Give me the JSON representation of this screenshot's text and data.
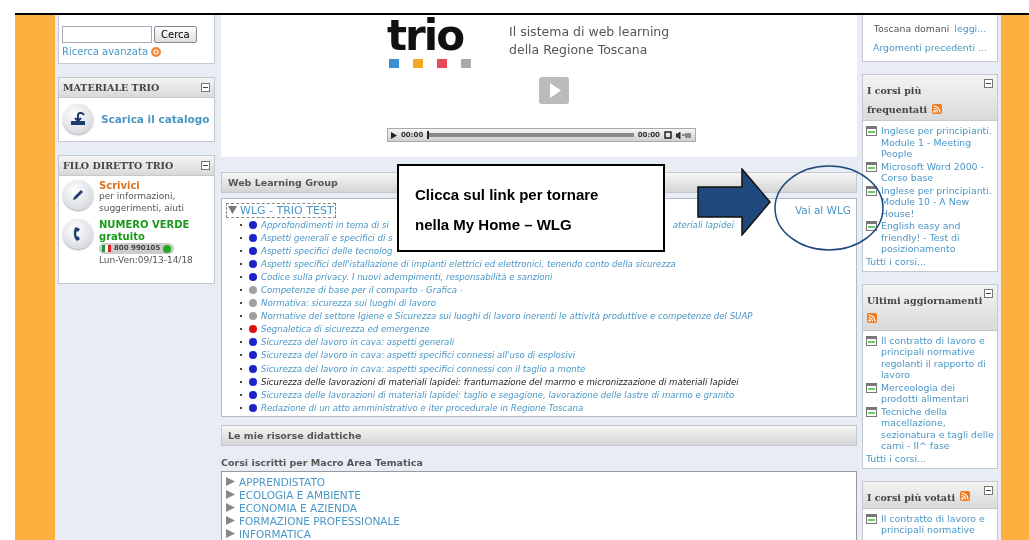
{
  "search_panel": {
    "button": "Cerca",
    "advanced_link": "Ricerca avanzata"
  },
  "material_panel": {
    "title": "MATERIALE TRIO",
    "link": "Scarica il catalogo"
  },
  "contact_panel": {
    "title": "FILO DIRETTO TRIO",
    "write_title": "Scrivici",
    "write_text": "per informazioni, suggerimenti, aiuti",
    "phone_title": "NUMERO VERDE gratuito",
    "phone_number": "800 990105",
    "hours": "Lun-Ven:09/13-14/18"
  },
  "banner": {
    "logo": "trio",
    "tagline": [
      "Il sistema di web learning",
      "della Regione Toscana"
    ],
    "player": {
      "elapsed": "00:00",
      "total": "00:00",
      "level": 0
    }
  },
  "web_learning_group": {
    "title": "Web Learning Group",
    "group": {
      "label": "WLG - TRIO TEST",
      "expanded": true,
      "link": "Vai al WLG",
      "items": [
        {
          "text": "Approfondimenti in tema di si",
          "tail": "ateriali lapidei",
          "color": "#1a22c8",
          "active": false
        },
        {
          "text": "Aspetti generali e specifici di s",
          "color": "#1a22c8",
          "active": false
        },
        {
          "text": "Aspetti specifici delle tecnolog",
          "color": "#1a22c8",
          "active": false
        },
        {
          "text": "Aspetti specifici dell'istallazione di impianti elettrici ed elettronici, tenendo conto della sicurezza",
          "color": "#1a22c8",
          "active": false
        },
        {
          "text": "Codice sulla privacy. I nuovi adempimenti, responsabilità e sanzioni",
          "color": "#1a22c8",
          "active": false
        },
        {
          "text": "Competenze di base per il comparto - Grafica -",
          "color": "#a0a0a0",
          "active": false
        },
        {
          "text": "Normativa: sicurezza sui luoghi di lavoro",
          "color": "#a0a0a0",
          "active": false
        },
        {
          "text": "Normative del settore Igiene e Sicurezza sui luoghi di lavoro inerenti le attività produttive e competenze del SUAP",
          "color": "#a0a0a0",
          "active": false
        },
        {
          "text": "Segnaletica di sicurezza ed emergenze",
          "color": "#dd1111",
          "active": false
        },
        {
          "text": "Sicurezza del lavoro in cava: aspetti generali",
          "color": "#1a22c8",
          "active": false
        },
        {
          "text": "Sicurezza del lavoro in cava: aspetti specifici connessi all'uso di esplosivi",
          "color": "#1a22c8",
          "active": false
        },
        {
          "text": "Sicurezza del lavoro in cava: aspetti specifici connessi con il taglio a monte",
          "color": "#1a22c8",
          "active": false
        },
        {
          "text": "Sicurezza delle lavorazioni di materiali lapidei: frantumazione del marmo e micronizzazione di materiali lapidei",
          "color": "#1a22c8",
          "active": true
        },
        {
          "text": "Sicurezza delle lavorazioni di materiali lapidei: taglio e segagione, lavorazione delle lastre di marmo e granito",
          "color": "#1a22c8",
          "active": false
        },
        {
          "text": "Redazione di un atto amministrativo e iter procedurale in Regione Toscana",
          "color": "#1a22c8",
          "active": false
        }
      ]
    }
  },
  "resources": {
    "title": "Le mie risorse didattiche",
    "subtitle": "Corsi iscritti per Macro Area Tematica",
    "categories": [
      {
        "label": "APPRENDISTATO",
        "expanded": false
      },
      {
        "label": "ECOLOGIA E AMBIENTE",
        "expanded": false
      },
      {
        "label": "ECONOMIA E AZIENDA",
        "expanded": false
      },
      {
        "label": "FORMAZIONE PROFESSIONALE",
        "expanded": false
      },
      {
        "label": "INFORMATICA",
        "expanded": false
      }
    ]
  },
  "news_panel": {
    "text": "Toscana domani",
    "link": "leggi...",
    "more": "Argomenti precedenti ..."
  },
  "course_panels": [
    {
      "title": "I corsi più frequentati",
      "items": [
        "Inglese per principianti. Module 1 - Meeting People",
        "Microsoft Word 2000 - Corso base",
        "Inglese per principianti. Module 10 - A New House!",
        "English easy and friendly! - Test di posizionamento"
      ],
      "all_link": "Tutti i corsi..."
    },
    {
      "title": "Ultimi aggiornamenti",
      "items": [
        "Il contratto di lavoro e principali normative regolanti il rapporto di lavoro",
        "Merceologia dei prodotti alimentari",
        "Tecniche della macellazione, sezionatura e tagli delle carni - II^ fase"
      ],
      "all_link": "Tutti i corsi..."
    },
    {
      "title": "I corsi più votati",
      "items": [
        "Il contratto di lavoro e principali normative"
      ]
    }
  ],
  "annotation": {
    "callout": "Clicca sul link per tornare nella My Home – WLG"
  }
}
